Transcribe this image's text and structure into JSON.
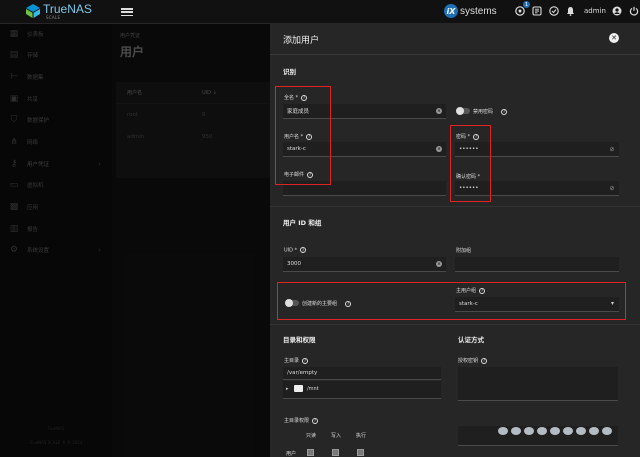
{
  "brand": {
    "name": "TrueNAS",
    "edition": "SCALE"
  },
  "topbar": {
    "vendor_mark": "iX",
    "vendor_text": "systems",
    "notification_count": "1",
    "username": "admin",
    "icons": [
      "hamburger-icon",
      "truecommand-icon",
      "jobs-icon",
      "directory-icon",
      "bell-icon",
      "account-icon",
      "power-icon"
    ]
  },
  "sidebar": {
    "items": [
      {
        "label": "仪表板",
        "icon": "dashboard-icon"
      },
      {
        "label": "存储",
        "icon": "storage-icon"
      },
      {
        "label": "数据集",
        "icon": "datasets-icon"
      },
      {
        "label": "共享",
        "icon": "shares-icon"
      },
      {
        "label": "数据保护",
        "icon": "shield-icon"
      },
      {
        "label": "网络",
        "icon": "network-icon"
      },
      {
        "label": "用户凭证",
        "icon": "key-icon",
        "has_children": true
      },
      {
        "label": "虚拟机",
        "icon": "vm-icon"
      },
      {
        "label": "应用",
        "icon": "apps-icon"
      },
      {
        "label": "报告",
        "icon": "reports-icon"
      },
      {
        "label": "系统设置",
        "icon": "gear-icon",
        "has_children": true
      }
    ],
    "footer_line1": "TrueNAS",
    "footer_line2": "TrueNAS SCALE ® © 2024"
  },
  "background_page": {
    "breadcrumb": "用户凭证",
    "title": "用户",
    "table": {
      "columns": [
        "用户名",
        "UID ↓"
      ],
      "rows": [
        [
          "root",
          "0"
        ],
        [
          "admin",
          "950"
        ]
      ]
    }
  },
  "panel": {
    "title": "添加用户",
    "identification": {
      "section_title": "识别",
      "full_name_label": "全名 *",
      "full_name_value": "家庭成员",
      "disable_password_label": "禁用密码",
      "username_label": "用户名 *",
      "username_value": "stark-c",
      "password_label": "密码 *",
      "password_value": "••••••",
      "email_label": "电子邮件",
      "email_value": "",
      "confirm_password_label": "确认密码 *",
      "confirm_password_value": "••••••"
    },
    "ids_groups": {
      "section_title": "用户 ID 和组",
      "uid_label": "UID *",
      "uid_value": "3000",
      "aux_groups_label": "附加组",
      "create_primary_label": "创建新的主要组",
      "primary_group_label": "主用户组",
      "primary_group_value": "stark-c"
    },
    "directories": {
      "section_title": "目录和权限",
      "home_dir_label": "主目录",
      "home_dir_value": "/var/empty",
      "tree_item": "/mnt",
      "home_perm_label": "主目录权限",
      "perm_columns": [
        "只读",
        "写入",
        "执行"
      ],
      "perm_row_user": "用户"
    },
    "authentication": {
      "section_title": "认证方式",
      "ssh_key_label": "授权密钥"
    }
  },
  "colors": {
    "accent": "#1e6fb3",
    "highlight_box": "#e02424",
    "panel_bg": "#262626",
    "topbar_bg": "#111111"
  }
}
